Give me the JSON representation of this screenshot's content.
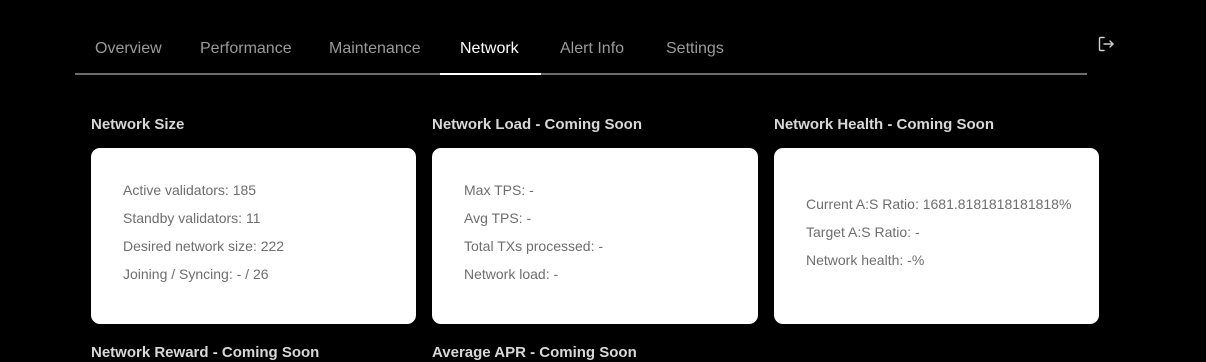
{
  "nav": {
    "tabs": [
      {
        "label": "Overview",
        "active": false
      },
      {
        "label": "Performance",
        "active": false
      },
      {
        "label": "Maintenance",
        "active": false
      },
      {
        "label": "Network",
        "active": true
      },
      {
        "label": "Alert Info",
        "active": false
      },
      {
        "label": "Settings",
        "active": false
      }
    ],
    "logout_icon": "logout-icon"
  },
  "sections": {
    "network_size": {
      "title": "Network Size",
      "lines": [
        "Active validators: 185",
        "Standby validators: 11",
        "Desired network size: 222",
        "Joining / Syncing: - / 26"
      ]
    },
    "network_load": {
      "title": "Network Load - Coming Soon",
      "lines": [
        "Max TPS: -",
        "Avg TPS: -",
        "Total TXs processed: -",
        "Network load: -"
      ]
    },
    "network_health": {
      "title": "Network Health - Coming Soon",
      "lines": [
        "Current A:S Ratio: 1681.8181818181818%",
        "Target A:S Ratio: -",
        "Network health: -%"
      ]
    },
    "network_reward": {
      "title": "Network Reward - Coming Soon"
    },
    "average_apr": {
      "title": "Average APR - Coming Soon"
    }
  },
  "colors": {
    "background": "#000000",
    "card": "#ffffff",
    "tab_inactive": "#9a9a9a",
    "tab_active": "#ffffff",
    "title": "#d8d8d8",
    "card_text": "#6e6e6e"
  }
}
